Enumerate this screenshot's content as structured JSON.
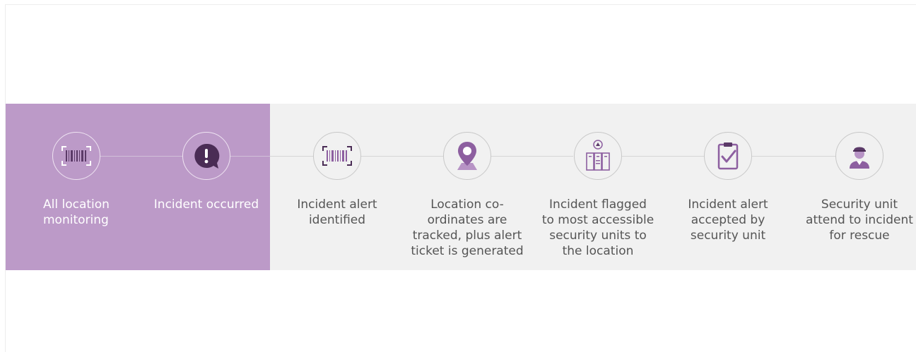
{
  "steps": [
    {
      "label": "All location\nmonitoring",
      "icon": "barcode-icon",
      "highlighted": true
    },
    {
      "label": "Incident occurred",
      "icon": "alert-speech-icon",
      "highlighted": true
    },
    {
      "label": "Incident alert\nidentified",
      "icon": "barcode-icon",
      "highlighted": false
    },
    {
      "label": "Location co-\nordinates are\ntracked, plus alert\nticket is generated",
      "icon": "location-pin-icon",
      "highlighted": false
    },
    {
      "label": "Incident flagged\nto most accessible\nsecurity units to\nthe location",
      "icon": "security-units-icon",
      "highlighted": false
    },
    {
      "label": "Incident alert\naccepted by\nsecurity unit",
      "icon": "checklist-icon",
      "highlighted": false
    },
    {
      "label": "Security unit\nattend to incident\nfor rescue",
      "icon": "security-officer-icon",
      "highlighted": false
    }
  ],
  "colors": {
    "highlight": "#bc9ac8",
    "band": "#f1f1f1",
    "icon_dark": "#5b3a68",
    "icon_purple": "#8d5fa0",
    "text_dark": "#555555"
  }
}
